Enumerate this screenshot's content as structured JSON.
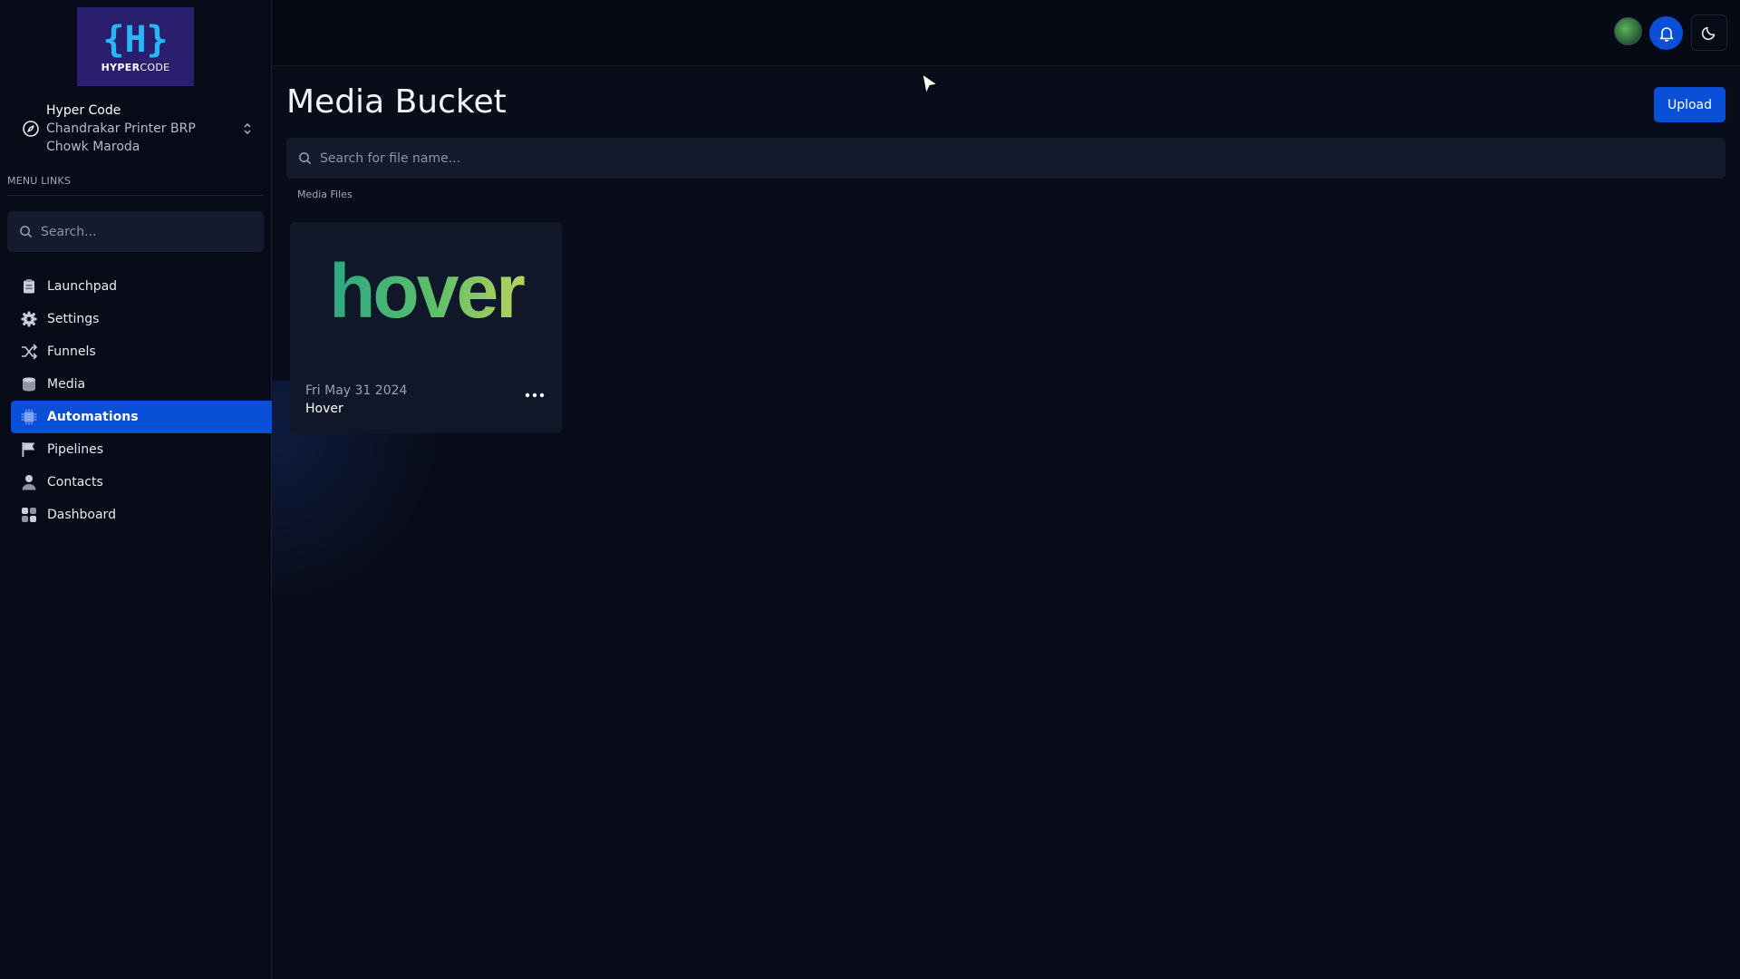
{
  "sidebar": {
    "logo": {
      "text_bold": "HYPER",
      "text_light": "CODE",
      "mark": "{H}"
    },
    "account": {
      "name": "Hyper Code",
      "address": "Chandrakar Printer BRP Chowk Maroda",
      "icon": "compass-icon",
      "switch_icon": "chevron-up-down-icon"
    },
    "menu_caption": "MENU LINKS",
    "search_placeholder": "Search...",
    "items": [
      {
        "label": "Launchpad",
        "icon": "clipboard-icon",
        "active": false
      },
      {
        "label": "Settings",
        "icon": "gear-icon",
        "active": false
      },
      {
        "label": "Funnels",
        "icon": "shuffle-icon",
        "active": false
      },
      {
        "label": "Media",
        "icon": "database-icon",
        "active": false
      },
      {
        "label": "Automations",
        "icon": "chip-icon",
        "active": true
      },
      {
        "label": "Pipelines",
        "icon": "flag-icon",
        "active": false
      },
      {
        "label": "Contacts",
        "icon": "person-icon",
        "active": false
      },
      {
        "label": "Dashboard",
        "icon": "grid-icon",
        "active": false
      }
    ]
  },
  "topbar": {
    "avatar": "user-avatar",
    "notifications_icon": "bell-icon",
    "theme_icon": "moon-icon"
  },
  "main": {
    "title": "Media Bucket",
    "upload_label": "Upload",
    "search_placeholder": "Search for file name...",
    "section_label": "Media Files",
    "files": [
      {
        "date": "Fri May 31 2024",
        "name": "Hover",
        "image_text": "hover"
      }
    ]
  },
  "colors": {
    "accent": "#0a4fd8",
    "background": "#090d1a",
    "sidebar": "#070b17",
    "card": "#101728"
  }
}
